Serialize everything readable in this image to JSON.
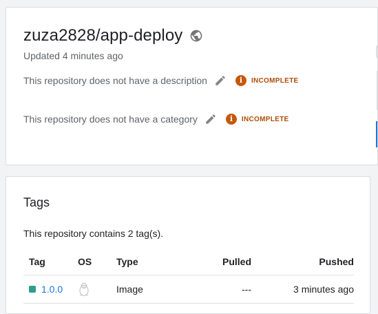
{
  "repo": {
    "title": "zuza2828/app-deploy",
    "updated": "Updated 4 minutes ago",
    "description_text": "This repository does not have a description",
    "description_status": "INCOMPLETE",
    "category_text": "This repository does not have a category",
    "category_status": "INCOMPLETE",
    "visibility_icon": "globe-icon",
    "edit_icon": "pencil-icon",
    "status_icon": "info-icon"
  },
  "tags": {
    "title": "Tags",
    "summary": "This repository contains 2 tag(s).",
    "columns": {
      "tag": "Tag",
      "os": "OS",
      "type": "Type",
      "pulled": "Pulled",
      "pushed": "Pushed"
    },
    "rows": [
      {
        "tag": "1.0.0",
        "os_icon": "linux-icon",
        "type": "Image",
        "pulled": "---",
        "pushed": "3 minutes ago"
      }
    ]
  },
  "colors": {
    "accent": "#1a73e8",
    "status": "#c5580c",
    "tag_dot": "#2e9e8a"
  }
}
